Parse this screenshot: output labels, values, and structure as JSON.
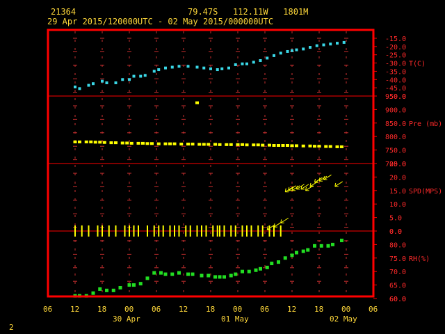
{
  "header": {
    "station_id": "21364",
    "location": "79.47S   112.11W   1801M",
    "period": "29 Apr 2015/120000UTC - 02 May 2015/000000UTC"
  },
  "footer": {
    "page_number": "2"
  },
  "x_axis": {
    "ticks": [
      {
        "t": -6,
        "label": "06"
      },
      {
        "t": 0,
        "label": "12"
      },
      {
        "t": 6,
        "label": "18"
      },
      {
        "t": 12,
        "label": "00"
      },
      {
        "t": 18,
        "label": "06"
      },
      {
        "t": 24,
        "label": "12"
      },
      {
        "t": 30,
        "label": "18"
      },
      {
        "t": 36,
        "label": "00"
      },
      {
        "t": 42,
        "label": "06"
      },
      {
        "t": 48,
        "label": "12"
      },
      {
        "t": 54,
        "label": "18"
      },
      {
        "t": 60,
        "label": "00"
      },
      {
        "t": 66,
        "label": "06"
      }
    ],
    "dates": [
      {
        "t": 12,
        "label": "30 Apr"
      },
      {
        "t": 36,
        "label": "01 May"
      },
      {
        "t": 60,
        "label": "02 May"
      }
    ],
    "range": [
      -6,
      66
    ],
    "unit_note": "hours relative to 29 Apr 2015 12 UTC"
  },
  "colors": {
    "frame": "#ff0000",
    "temperature": "#3ad7e6",
    "pressure": "#ffff00",
    "wind": "#ffff00",
    "humidity": "#22dd22",
    "grid": "#cc3030",
    "labels": "#ffd83a"
  },
  "chart_data": [
    {
      "type": "scatter",
      "name_label": "T(C)",
      "ylim": [
        -50,
        -15
      ],
      "yticks": [
        "-15.0",
        "-20.0",
        "-25.0",
        "-30.0",
        "-35.0",
        "-40.0",
        "-45.0"
      ],
      "points": [
        [
          0,
          -44.5
        ],
        [
          1,
          -45.5
        ],
        [
          3,
          -43.5
        ],
        [
          4,
          -42.5
        ],
        [
          6,
          -41
        ],
        [
          7,
          -42
        ],
        [
          9,
          -42
        ],
        [
          10.5,
          -40
        ],
        [
          12,
          -40
        ],
        [
          13,
          -38
        ],
        [
          14.5,
          -38
        ],
        [
          15.5,
          -37.5
        ],
        [
          17.5,
          -35
        ],
        [
          18.5,
          -34
        ],
        [
          20,
          -33
        ],
        [
          21.5,
          -32.5
        ],
        [
          23,
          -32
        ],
        [
          25,
          -32
        ],
        [
          27,
          -32.5
        ],
        [
          28.5,
          -33
        ],
        [
          30,
          -33.5
        ],
        [
          31.5,
          -34
        ],
        [
          32.5,
          -33.5
        ],
        [
          34,
          -33
        ],
        [
          35.5,
          -31
        ],
        [
          37,
          -30.5
        ],
        [
          38,
          -30.5
        ],
        [
          39.5,
          -29.5
        ],
        [
          41,
          -28.5
        ],
        [
          42.5,
          -27
        ],
        [
          44,
          -25.5
        ],
        [
          45.5,
          -24
        ],
        [
          47,
          -23
        ],
        [
          48,
          -22.5
        ],
        [
          49,
          -22
        ],
        [
          50.5,
          -21.5
        ],
        [
          52,
          -20.5
        ],
        [
          53.5,
          -19.5
        ],
        [
          55,
          -19
        ],
        [
          56.5,
          -18.5
        ],
        [
          58,
          -18
        ],
        [
          59.5,
          -17.5
        ]
      ]
    },
    {
      "type": "scatter",
      "name_label": "Pre (mb)",
      "ylim": [
        700,
        950
      ],
      "yticks": [
        "950.0",
        "900.0",
        "850.0",
        "800.0",
        "750.0"
      ],
      "points": [
        [
          0,
          780
        ],
        [
          1,
          780
        ],
        [
          2.5,
          780
        ],
        [
          3.5,
          780
        ],
        [
          4.5,
          779
        ],
        [
          5.5,
          779
        ],
        [
          6.5,
          778
        ],
        [
          8,
          777
        ],
        [
          9,
          777
        ],
        [
          10.5,
          776
        ],
        [
          11.5,
          776
        ],
        [
          12.5,
          775
        ],
        [
          14,
          775
        ],
        [
          15,
          775
        ],
        [
          16,
          774
        ],
        [
          17,
          774
        ],
        [
          18.5,
          773
        ],
        [
          20,
          773
        ],
        [
          21,
          773
        ],
        [
          22,
          773
        ],
        [
          23.5,
          772
        ],
        [
          25,
          772
        ],
        [
          26,
          772
        ],
        [
          27.5,
          771
        ],
        [
          28.5,
          771
        ],
        [
          29.5,
          771
        ],
        [
          31,
          771
        ],
        [
          32,
          770
        ],
        [
          33.5,
          770
        ],
        [
          34.5,
          770
        ],
        [
          36,
          770
        ],
        [
          37,
          770
        ],
        [
          38,
          769
        ],
        [
          39.5,
          769
        ],
        [
          40.5,
          769
        ],
        [
          41.5,
          768
        ],
        [
          43,
          768
        ],
        [
          44,
          767
        ],
        [
          45,
          767
        ],
        [
          46,
          767
        ],
        [
          47,
          767
        ],
        [
          48,
          766
        ],
        [
          49,
          766
        ],
        [
          50.5,
          765
        ],
        [
          52,
          765
        ],
        [
          53,
          764
        ],
        [
          54,
          764
        ],
        [
          55.5,
          763
        ],
        [
          56.5,
          763
        ],
        [
          58,
          762
        ],
        [
          59,
          762
        ],
        [
          27,
          925
        ]
      ]
    },
    {
      "type": "scatter",
      "name_label": "SPD(MPS)",
      "ylim": [
        0,
        25
      ],
      "yticks": [
        "25.0",
        "20.0",
        "15.0",
        "10.0",
        "5.0",
        "0.0"
      ],
      "calm_times": [
        0,
        1.5,
        3,
        5,
        6,
        7.5,
        9,
        11,
        12,
        13,
        14,
        16,
        17.5,
        18.5,
        19.5,
        21,
        22,
        23,
        24.5,
        25.5,
        27,
        28,
        29,
        30.5,
        31.5,
        32,
        33,
        34.5,
        35.5,
        37,
        38,
        39,
        40.5,
        41.5,
        43,
        44,
        45.5
      ],
      "barbs": [
        {
          "t": 42.5,
          "spd": 0.5
        },
        {
          "t": 44,
          "spd": 1.5
        },
        {
          "t": 45.5,
          "spd": 3
        },
        {
          "t": 46.5,
          "spd": 14.5
        },
        {
          "t": 47.2,
          "spd": 15
        },
        {
          "t": 48,
          "spd": 15
        },
        {
          "t": 49,
          "spd": 15.5
        },
        {
          "t": 50,
          "spd": 15.5
        },
        {
          "t": 51,
          "spd": 15
        },
        {
          "t": 52,
          "spd": 16.5
        },
        {
          "t": 53,
          "spd": 18
        },
        {
          "t": 54,
          "spd": 18.5
        },
        {
          "t": 55,
          "spd": 19
        },
        {
          "t": 57.5,
          "spd": 16.5
        }
      ]
    },
    {
      "type": "scatter",
      "name_label": "RH(%)",
      "ylim": [
        60,
        85
      ],
      "yticks": [
        "80.0",
        "75.0",
        "70.0",
        "65.0",
        "60.0"
      ],
      "points": [
        [
          0,
          61
        ],
        [
          1,
          61
        ],
        [
          2.5,
          61
        ],
        [
          4,
          62
        ],
        [
          5.5,
          63.5
        ],
        [
          7,
          63
        ],
        [
          8.5,
          63
        ],
        [
          10,
          64
        ],
        [
          12,
          65
        ],
        [
          13,
          65
        ],
        [
          14.5,
          65.5
        ],
        [
          16,
          67.5
        ],
        [
          17.5,
          69.5
        ],
        [
          19,
          69.5
        ],
        [
          20,
          69
        ],
        [
          21.5,
          69
        ],
        [
          23,
          69.5
        ],
        [
          25,
          69
        ],
        [
          26,
          69
        ],
        [
          28,
          68.5
        ],
        [
          29.5,
          68.5
        ],
        [
          31,
          68
        ],
        [
          32,
          68
        ],
        [
          33,
          68
        ],
        [
          34.5,
          68.5
        ],
        [
          35.5,
          69
        ],
        [
          37,
          70
        ],
        [
          38.5,
          70
        ],
        [
          40,
          70.5
        ],
        [
          41,
          71
        ],
        [
          42.5,
          71.5
        ],
        [
          43.5,
          73
        ],
        [
          45,
          73.5
        ],
        [
          46.5,
          75
        ],
        [
          48,
          76
        ],
        [
          49,
          77
        ],
        [
          50.5,
          77.5
        ],
        [
          51.5,
          78
        ],
        [
          53,
          79.5
        ],
        [
          54.5,
          79.5
        ],
        [
          56,
          79.5
        ],
        [
          57,
          80
        ],
        [
          59,
          81.5
        ]
      ]
    }
  ]
}
